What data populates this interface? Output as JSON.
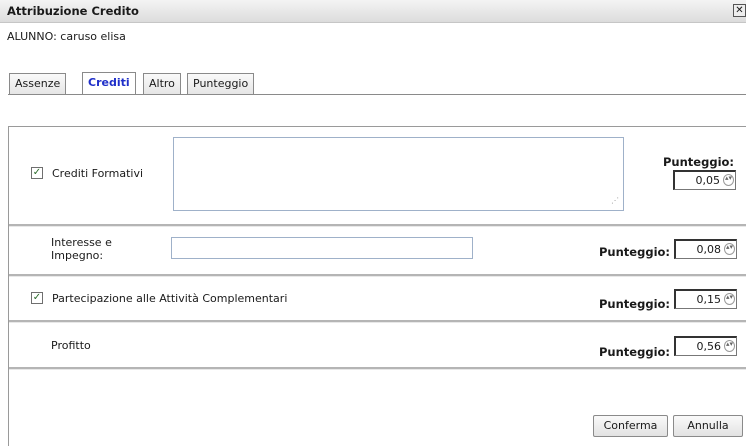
{
  "window": {
    "title": "Attribuzione Credito",
    "close_glyph": "✕"
  },
  "student": {
    "label": "ALUNNO: caruso elisa"
  },
  "tabs": [
    {
      "label": "Assenze",
      "active": false
    },
    {
      "label": "Crediti",
      "active": true
    },
    {
      "label": "Altro",
      "active": false
    },
    {
      "label": "Punteggio",
      "active": false
    }
  ],
  "rows": {
    "crediti_formativi": {
      "label": "Crediti Formativi",
      "checked": true,
      "text": "",
      "score_label": "Punteggio:",
      "score": "0,05"
    },
    "interesse": {
      "label_line1": "Interesse e",
      "label_line2": "Impegno:",
      "text": "",
      "score_label": "Punteggio:",
      "score": "0,08"
    },
    "partecipazione": {
      "label": "Partecipazione alle Attività Complementari",
      "checked": true,
      "score_label": "Punteggio:",
      "score": "0,15"
    },
    "profitto": {
      "label": "Profitto",
      "score_label": "Punteggio:",
      "score": "0,56"
    }
  },
  "buttons": {
    "confirm": "Conferma",
    "cancel": "Annulla"
  },
  "icons": {
    "checkbox": "checkbox-checked-icon",
    "spinner": "spinner-arrows-icon",
    "resize": "resize-grip-icon"
  }
}
